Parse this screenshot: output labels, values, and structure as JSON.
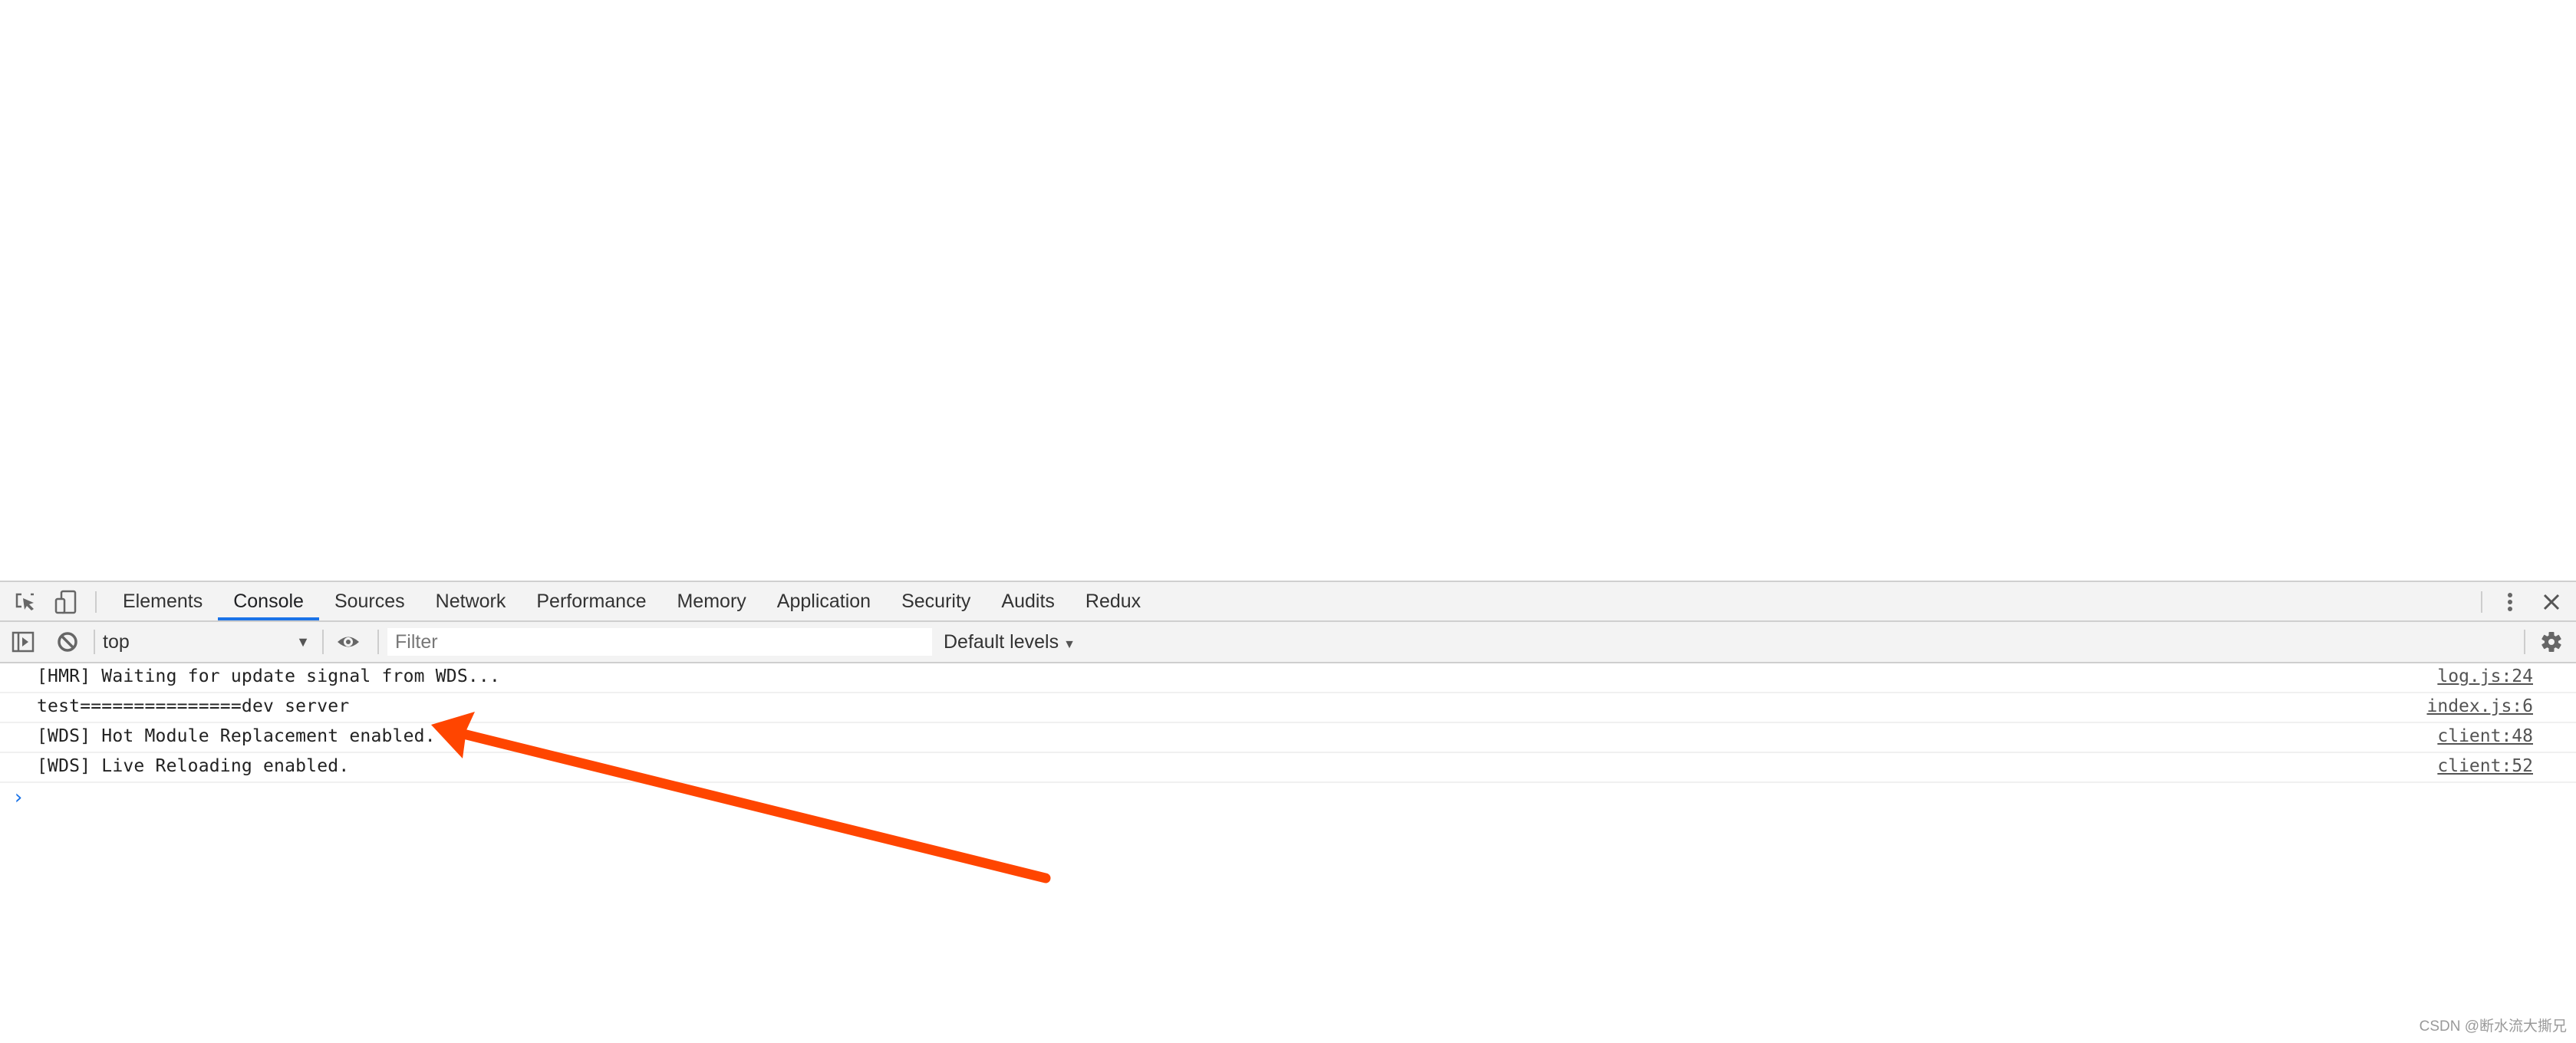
{
  "devtools": {
    "toolbar_icons": {
      "inspect": "inspect-element-icon",
      "device": "device-toolbar-icon",
      "more": "more-vertical-icon",
      "close": "close-icon"
    },
    "tabs": [
      {
        "label": "Elements",
        "active": false
      },
      {
        "label": "Console",
        "active": true
      },
      {
        "label": "Sources",
        "active": false
      },
      {
        "label": "Network",
        "active": false
      },
      {
        "label": "Performance",
        "active": false
      },
      {
        "label": "Memory",
        "active": false
      },
      {
        "label": "Application",
        "active": false
      },
      {
        "label": "Security",
        "active": false
      },
      {
        "label": "Audits",
        "active": false
      },
      {
        "label": "Redux",
        "active": false
      }
    ],
    "accent_color": "#1a73e8"
  },
  "console_toolbar": {
    "sidebar_icon": "show-sidebar-icon",
    "clear_icon": "clear-console-icon",
    "context": "top",
    "eye_icon": "live-expression-icon",
    "filter_value": "",
    "filter_placeholder": "Filter",
    "levels": "Default levels",
    "settings_icon": "gear-icon"
  },
  "messages": [
    {
      "text": "[HMR] Waiting for update signal from WDS...",
      "source": "log.js:24"
    },
    {
      "text": "test===============dev server",
      "source": "index.js:6"
    },
    {
      "text": "[WDS] Hot Module Replacement enabled.",
      "source": "client:48"
    },
    {
      "text": "[WDS] Live Reloading enabled.",
      "source": "client:52"
    }
  ],
  "prompt_symbol": "›",
  "annotation": {
    "type": "arrow",
    "color": "#ff4500",
    "points_to": "test===============dev server"
  },
  "watermark": "CSDN @断水流大撕兄"
}
